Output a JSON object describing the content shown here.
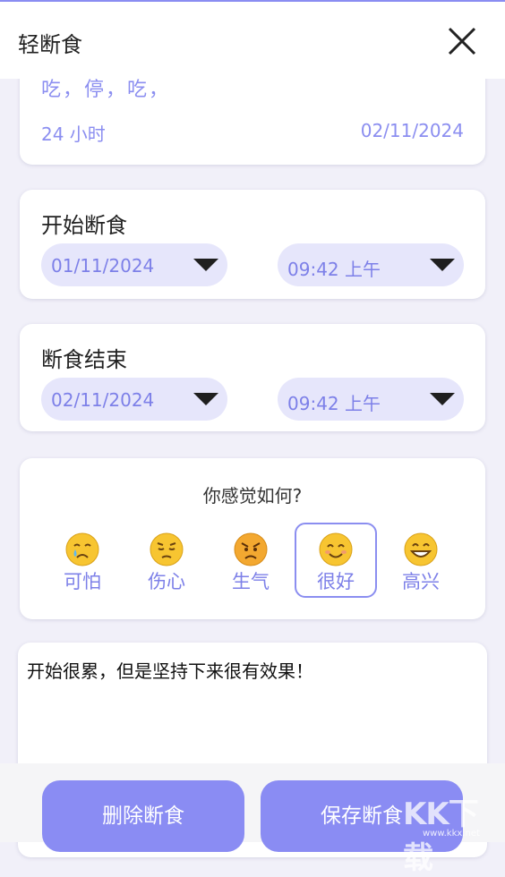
{
  "header": {
    "title": "轻断食"
  },
  "summary": {
    "pattern": "吃，停，吃，",
    "duration": "24 小时",
    "date": "02/11/2024"
  },
  "start": {
    "label": "开始断食",
    "date": "01/11/2024",
    "time": "09:42 上午"
  },
  "end": {
    "label": "断食结束",
    "date": "02/11/2024",
    "time": "09:42 上午"
  },
  "mood": {
    "question": "你感觉如何?",
    "selected": "很好",
    "options": [
      {
        "label": "可怕",
        "icon": "crying-face-icon"
      },
      {
        "label": "伤心",
        "icon": "pensive-face-icon"
      },
      {
        "label": "生气",
        "icon": "angry-face-icon"
      },
      {
        "label": "很好",
        "icon": "smiling-face-icon"
      },
      {
        "label": "高兴",
        "icon": "grinning-face-icon"
      }
    ]
  },
  "note": {
    "text": "开始很累，但是坚持下来很有效果！"
  },
  "actions": {
    "delete": "删除断食",
    "save": "保存断食"
  },
  "watermark": {
    "brand": "KK下载",
    "url": "www.kkx.net"
  },
  "colors": {
    "accent": "#8a8cf3",
    "accent_text": "#7d80e8",
    "pill_bg": "#e6e6fb",
    "page_bg": "#f1f0f9"
  }
}
